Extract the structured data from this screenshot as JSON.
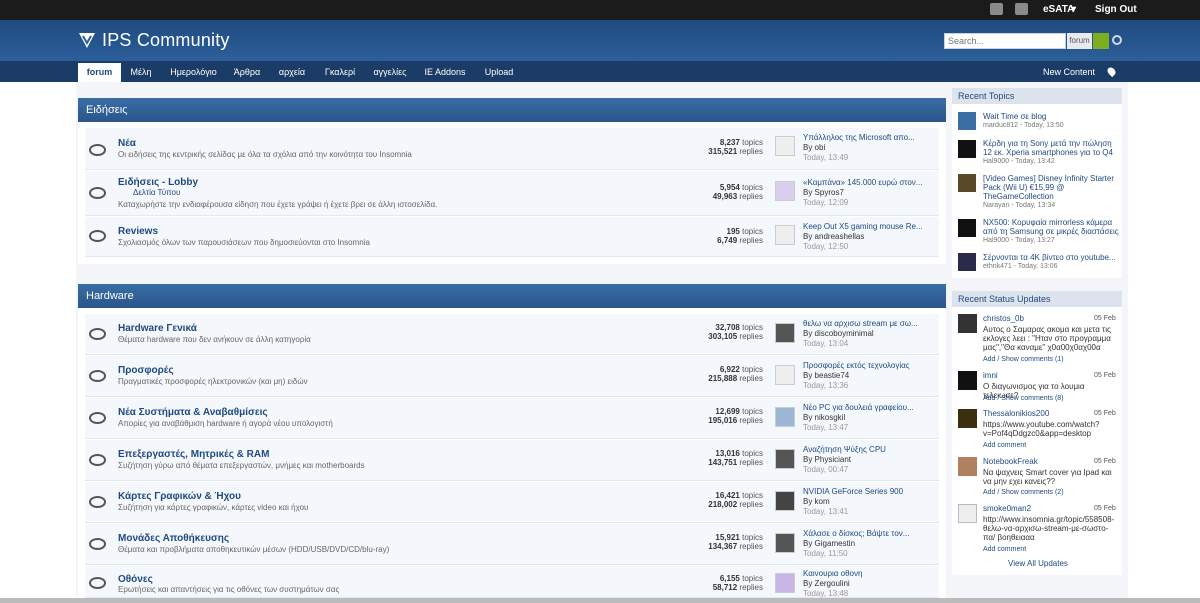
{
  "userbar": {
    "username": "eSATA",
    "signout": "Sign Out"
  },
  "brand": {
    "name": "IPS Community"
  },
  "search": {
    "placeholder": "Search...",
    "scope": "forum"
  },
  "nav": {
    "tabs": [
      "forum",
      "Μέλη",
      "Ημερολόγιο",
      "Άρθρα",
      "αρχεία",
      "Γκαλερί",
      "αγγελίες",
      "IE Addons",
      "Upload"
    ],
    "new_content": "New Content"
  },
  "categories": [
    {
      "title": "Ειδήσεις",
      "forums": [
        {
          "name": "Νέα",
          "desc": "Οι ειδήσεις της κεντρικής σελίδας με όλα τα σχόλια από την κοινότητα του Insomnia",
          "topics": "8,237",
          "replies": "315,521",
          "last_title": "Υπάλληλος της Microsoft απο...",
          "last_by": "By obi",
          "last_date": "Today, 13:49"
        },
        {
          "name": "Ειδήσεις - Lobby",
          "sub": "Δελτία Τύπου",
          "desc": "Καταχωρήστε την ενδιαφέρουσα είδηση που έχετε γράψει ή έχετε βρει σε άλλη ιστοσελίδα.",
          "topics": "5,954",
          "replies": "49,963",
          "last_title": "«Καμπάνα» 145.000 ευρώ στον...",
          "last_by": "By Spyros7",
          "last_date": "Today, 12:09"
        },
        {
          "name": "Reviews",
          "desc": "Σχολιασμός όλων των παρουσιάσεων που δημοσιεύονται στο Insomnia",
          "topics": "195",
          "replies": "6,749",
          "last_title": "Keep Out X5 gaming mouse Re...",
          "last_by": "By andreashellas",
          "last_date": "Today, 12:50"
        }
      ]
    },
    {
      "title": "Hardware",
      "forums": [
        {
          "name": "Hardware Γενικά",
          "desc": "Θέματα hardware που δεν ανήκουν σε άλλη κατηγορία",
          "topics": "32,708",
          "replies": "303,105",
          "last_title": "θελω να αρχισω stream με σω...",
          "last_by": "By discoboyminimal",
          "last_date": "Today, 13:04"
        },
        {
          "name": "Προσφορές",
          "desc": "Πραγματικές προσφορές ηλεκτρονικών (και μη) ειδών",
          "topics": "6,922",
          "replies": "215,888",
          "last_title": "Προσφορές εκτός τεχνολογίας",
          "last_by": "By beastie74",
          "last_date": "Today, 13:36"
        },
        {
          "name": "Νέα Συστήματα & Αναβαθμίσεις",
          "desc": "Απορίες για αναβάθμιση hardware ή αγορά νέου υπολογιστή",
          "topics": "12,699",
          "replies": "195,016",
          "last_title": "Νέο PC για δουλειά γραφείου...",
          "last_by": "By nikosgkil",
          "last_date": "Today, 13:47"
        },
        {
          "name": "Επεξεργαστές, Μητρικές & RAM",
          "desc": "Συζήτηση γύρω από θέματα επεξεργαστών, μνήμες και motherboards",
          "topics": "13,016",
          "replies": "143,751",
          "last_title": "Αναζήτηση Ψύξης CPU",
          "last_by": "By Physiciant",
          "last_date": "Today, 00:47"
        },
        {
          "name": "Κάρτες Γραφικών & Ήχου",
          "desc": "Συζήτηση για κάρτες γραφικών, κάρτες video και ήχου",
          "topics": "16,421",
          "replies": "218,002",
          "last_title": "NVIDIA GeForce Series 900",
          "last_by": "By kom",
          "last_date": "Today, 13:41"
        },
        {
          "name": "Μονάδες Αποθήκευσης",
          "desc": "Θέματα και προβλήματα αποθηκευτικών μέσων (HDD/USB/DVD/CD/blu-ray)",
          "topics": "15,921",
          "replies": "134,367",
          "last_title": "Χάλασε ο δίσκος; Βάψτε τον...",
          "last_by": "By Gigamestin",
          "last_date": "Today, 11:50"
        },
        {
          "name": "Οθόνες",
          "desc": "Ερωτήσεις και απαντήσεις για τις οθόνες των συστημάτων σας",
          "topics": "6,155",
          "replies": "58,712",
          "last_title": "Καινουρια οθονη",
          "last_by": "By Zergoulini",
          "last_date": "Today, 13:48"
        }
      ]
    }
  ],
  "labels": {
    "topics": "topics",
    "replies": "replies"
  },
  "recent_topics": {
    "title": "Recent Topics",
    "items": [
      {
        "title": "Wait Time σε blog",
        "meta": "marduc812 - Today, 13:50"
      },
      {
        "title": "Κέρδη για τη Sony μετά την πώληση 12 εκ. Xperia smartphones για το Q4",
        "meta": "Hal9000 - Today, 13:42"
      },
      {
        "title": "[Video Games] Disney Infinity Starter Pack (Wii U) €15,99 @ TheGameCollection",
        "meta": "Narayan - Today, 13:34"
      },
      {
        "title": "NX500: Κορυφαία mirrorless κάμερα από τη Samsung σε μικρές διαστάσεις",
        "meta": "Hal9000 - Today, 13:27"
      },
      {
        "title": "Σέρνονται τα 4K βίντεο στο youtube...",
        "meta": "ethnk471 - Today, 13:06"
      }
    ]
  },
  "status_updates": {
    "title": "Recent Status Updates",
    "view_all": "View All Updates",
    "items": [
      {
        "name": "christos_0b",
        "date": "05 Feb",
        "text": "Αυτος ο Σαμαρας ακομα και μετα τις εκλογες λεει : \"Ηταν στο προγραμμα μας\",\"Θα καναμε\" χ0α00χ0αχ00α",
        "links": "Add / Show comments (1)"
      },
      {
        "name": "imni",
        "date": "05 Feb",
        "text": "Ο διαγωνισμος για το λουμια τελειωσε?",
        "links": "Add / Show comments (8)"
      },
      {
        "name": "Thessalonikios200",
        "date": "05 Feb",
        "text": "https://www.youtube.com/watch?v=Pof4qDdgzc0&app=desktop",
        "links": "Add comment"
      },
      {
        "name": "NotebookFreak",
        "date": "05 Feb",
        "text": "Να ψαχνεις Smart cover για Ipad και να μην εχει κανεις??",
        "links": "Add / Show comments (2)"
      },
      {
        "name": "smoke0man2",
        "date": "05 Feb",
        "text": "http://www.insomnia.gr/topic/558508-θελω-να-αρχισω-stream-με-σωστο-πα/ βοηθειααα",
        "links": "Add comment"
      }
    ]
  },
  "colors": {
    "header": "#2c5f9a",
    "nav": "#1a3c66",
    "link": "#1f4a80",
    "search_go": "#7cae20"
  },
  "icons": [
    "mail-icon",
    "notifications-icon",
    "gear-icon",
    "pin-icon",
    "chat-bubble-icon",
    "search-go-icon",
    "logo-icon"
  ]
}
